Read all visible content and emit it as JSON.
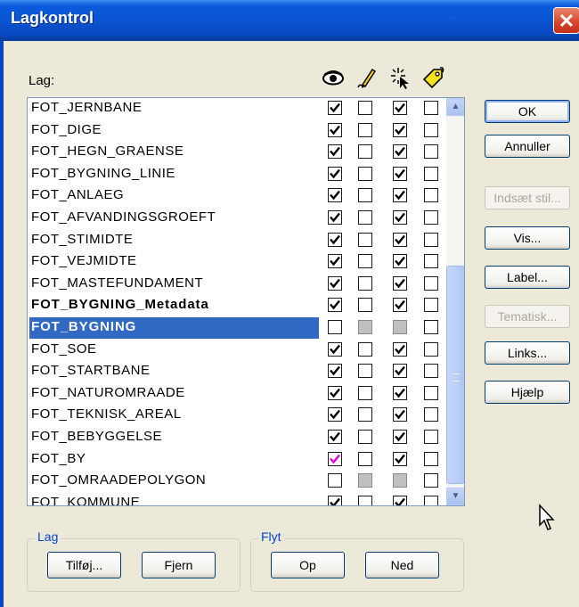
{
  "window": {
    "title": "Lagkontrol",
    "close_label": "✕"
  },
  "list_header": {
    "label": "Lag:",
    "columns": [
      {
        "icon": "eye-icon",
        "meaning": "visible"
      },
      {
        "icon": "pencil-icon",
        "meaning": "editable"
      },
      {
        "icon": "select-cursor-icon",
        "meaning": "selectable"
      },
      {
        "icon": "label-tag-icon",
        "meaning": "labeled"
      }
    ]
  },
  "layers": [
    {
      "name": "FOT_JERNBANE",
      "style": "normal",
      "checks": [
        "on",
        "off",
        "on",
        "off"
      ]
    },
    {
      "name": "FOT_DIGE",
      "style": "normal",
      "checks": [
        "on",
        "off",
        "on",
        "off"
      ]
    },
    {
      "name": "FOT_HEGN_GRAENSE",
      "style": "normal",
      "checks": [
        "on",
        "off",
        "on",
        "off"
      ]
    },
    {
      "name": "FOT_BYGNING_LINIE",
      "style": "normal",
      "checks": [
        "on",
        "off",
        "on",
        "off"
      ]
    },
    {
      "name": "FOT_ANLAEG",
      "style": "normal",
      "checks": [
        "on",
        "off",
        "on",
        "off"
      ]
    },
    {
      "name": "FOT_AFVANDINGSGROEFT",
      "style": "normal",
      "checks": [
        "on",
        "off",
        "on",
        "off"
      ]
    },
    {
      "name": "FOT_STIMIDTE",
      "style": "normal",
      "checks": [
        "on",
        "off",
        "on",
        "off"
      ]
    },
    {
      "name": "FOT_VEJMIDTE",
      "style": "normal",
      "checks": [
        "on",
        "off",
        "on",
        "off"
      ]
    },
    {
      "name": "FOT_MASTEFUNDAMENT",
      "style": "normal",
      "checks": [
        "on",
        "off",
        "on",
        "off"
      ]
    },
    {
      "name": "FOT_BYGNING_Metadata",
      "style": "bold",
      "checks": [
        "on",
        "off",
        "on",
        "off"
      ]
    },
    {
      "name": "FOT_BYGNING",
      "style": "selected",
      "checks": [
        "off",
        "grey",
        "grey",
        "off"
      ]
    },
    {
      "name": "FOT_SOE",
      "style": "normal",
      "checks": [
        "on",
        "off",
        "on",
        "off"
      ]
    },
    {
      "name": "FOT_STARTBANE",
      "style": "normal",
      "checks": [
        "on",
        "off",
        "on",
        "off"
      ]
    },
    {
      "name": "FOT_NATUROMRAADE",
      "style": "normal",
      "checks": [
        "on",
        "off",
        "on",
        "off"
      ]
    },
    {
      "name": "FOT_TEKNISK_AREAL",
      "style": "normal",
      "checks": [
        "on",
        "off",
        "on",
        "off"
      ]
    },
    {
      "name": "FOT_BEBYGGELSE",
      "style": "normal",
      "checks": [
        "on",
        "off",
        "on",
        "off"
      ]
    },
    {
      "name": "FOT_BY",
      "style": "normal",
      "checks": [
        "magenta",
        "off",
        "on",
        "off"
      ]
    },
    {
      "name": "FOT_OMRAADEPOLYGON",
      "style": "normal",
      "checks": [
        "off",
        "grey",
        "grey",
        "off"
      ]
    },
    {
      "name": "FOT_KOMMUNE",
      "style": "normal",
      "checks": [
        "on",
        "off",
        "on",
        "off"
      ]
    }
  ],
  "buttons": {
    "ok": "OK",
    "cancel": "Annuller",
    "insert_style": "Indsæt stil...",
    "show": "Vis...",
    "label": "Label...",
    "thematic": "Tematisk...",
    "links": "Links...",
    "help": "Hjælp"
  },
  "group_lag": {
    "title": "Lag",
    "add": "Tilføj...",
    "remove": "Fjern"
  },
  "group_flyt": {
    "title": "Flyt",
    "up": "Op",
    "down": "Ned"
  },
  "colors": {
    "selection": "#316ac5",
    "titlebar": "#0a55d3",
    "check_magenta": "#e000e0"
  }
}
